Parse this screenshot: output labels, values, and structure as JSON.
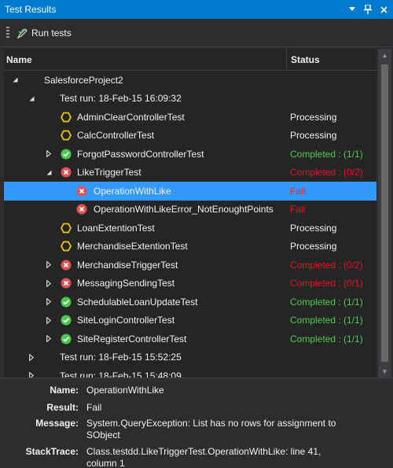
{
  "window": {
    "title": "Test Results"
  },
  "toolbar": {
    "run_label": "Run tests"
  },
  "columns": {
    "name": "Name",
    "status": "Status"
  },
  "colors": {
    "accent": "#007acc",
    "ok": "#4ec94e",
    "error": "#e81123",
    "pending": "#f0c800",
    "selected": "#3399ff"
  },
  "rows": [
    {
      "level": 0,
      "expander": "expanded",
      "icon": "",
      "label": "SalesforceProject2",
      "status": "",
      "status_kind": ""
    },
    {
      "level": 1,
      "expander": "expanded",
      "icon": "",
      "label": "Test run: 18-Feb-15 16:09:32",
      "status": "",
      "status_kind": ""
    },
    {
      "level": 2,
      "expander": "",
      "icon": "pending",
      "label": "AdminClearControllerTest",
      "status": "Processing",
      "status_kind": "processing"
    },
    {
      "level": 2,
      "expander": "",
      "icon": "pending",
      "label": "CalcControllerTest",
      "status": "Processing",
      "status_kind": "processing"
    },
    {
      "level": 2,
      "expander": "collapsed",
      "icon": "ok",
      "label": "ForgotPasswordControllerTest",
      "status": "Completed : (1/1)",
      "status_kind": "completed-ok"
    },
    {
      "level": 2,
      "expander": "expanded",
      "icon": "error",
      "label": "LikeTriggerTest",
      "status": "Completed : (0/2)",
      "status_kind": "completed-bad"
    },
    {
      "level": 3,
      "expander": "",
      "icon": "error",
      "label": "OperationWithLike",
      "status": "Fail",
      "status_kind": "fail",
      "selected": true
    },
    {
      "level": 3,
      "expander": "",
      "icon": "error",
      "label": "OperationWithLikeError_NotEnoughtPoints",
      "status": "Fail",
      "status_kind": "fail"
    },
    {
      "level": 2,
      "expander": "",
      "icon": "pending",
      "label": "LoanExtentionTest",
      "status": "Processing",
      "status_kind": "processing"
    },
    {
      "level": 2,
      "expander": "",
      "icon": "pending",
      "label": "MerchandiseExtentionTest",
      "status": "Processing",
      "status_kind": "processing"
    },
    {
      "level": 2,
      "expander": "collapsed",
      "icon": "error",
      "label": "MerchandiseTriggerTest",
      "status": "Completed : (0/2)",
      "status_kind": "completed-bad"
    },
    {
      "level": 2,
      "expander": "collapsed",
      "icon": "error",
      "label": "MessagingSendingTest",
      "status": "Completed : (0/1)",
      "status_kind": "completed-bad"
    },
    {
      "level": 2,
      "expander": "collapsed",
      "icon": "ok",
      "label": "SchedulableLoanUpdateTest",
      "status": "Completed : (1/1)",
      "status_kind": "completed-ok"
    },
    {
      "level": 2,
      "expander": "collapsed",
      "icon": "ok",
      "label": "SiteLoginControllerTest",
      "status": "Completed : (1/1)",
      "status_kind": "completed-ok"
    },
    {
      "level": 2,
      "expander": "collapsed",
      "icon": "ok",
      "label": "SiteRegisterControllerTest",
      "status": "Completed : (1/1)",
      "status_kind": "completed-ok"
    },
    {
      "level": 1,
      "expander": "collapsed",
      "icon": "",
      "label": "Test run: 18-Feb-15 15:52:25",
      "status": "",
      "status_kind": ""
    },
    {
      "level": 1,
      "expander": "collapsed",
      "icon": "",
      "label": "Test run: 18-Feb-15 15:48:09",
      "status": "",
      "status_kind": ""
    }
  ],
  "details": {
    "name_label": "Name:",
    "name_value": "OperationWithLike",
    "result_label": "Result:",
    "result_value": "Fail",
    "message_label": "Message:",
    "message_value": "System.QueryException: List has no rows for assignment to SObject",
    "stacktrace_label": "StackTrace:",
    "stacktrace_value": "Class.testdd.LikeTriggerTest.OperationWithLike: line 41, column 1"
  }
}
